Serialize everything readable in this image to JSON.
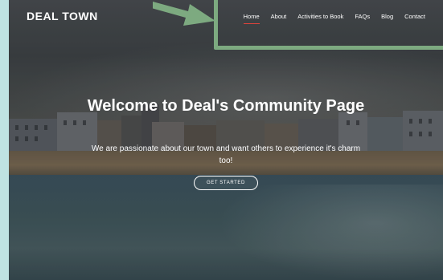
{
  "brand": "DEAL TOWN",
  "nav": [
    {
      "label": "Home",
      "active": true
    },
    {
      "label": "About",
      "active": false
    },
    {
      "label": "Activities to Book",
      "active": false
    },
    {
      "label": "FAQs",
      "active": false
    },
    {
      "label": "Blog",
      "active": false
    },
    {
      "label": "Contact",
      "active": false
    }
  ],
  "hero": {
    "title": "Welcome to Deal's Community Page",
    "subtitle": "We are passionate about our town and want others to experience it's charm too!",
    "cta": "GET STARTED"
  },
  "colors": {
    "page_bg": "#bfe3e2",
    "annotation_green": "#7daa80",
    "active_underline": "#e0433b",
    "text": "#ffffff"
  }
}
